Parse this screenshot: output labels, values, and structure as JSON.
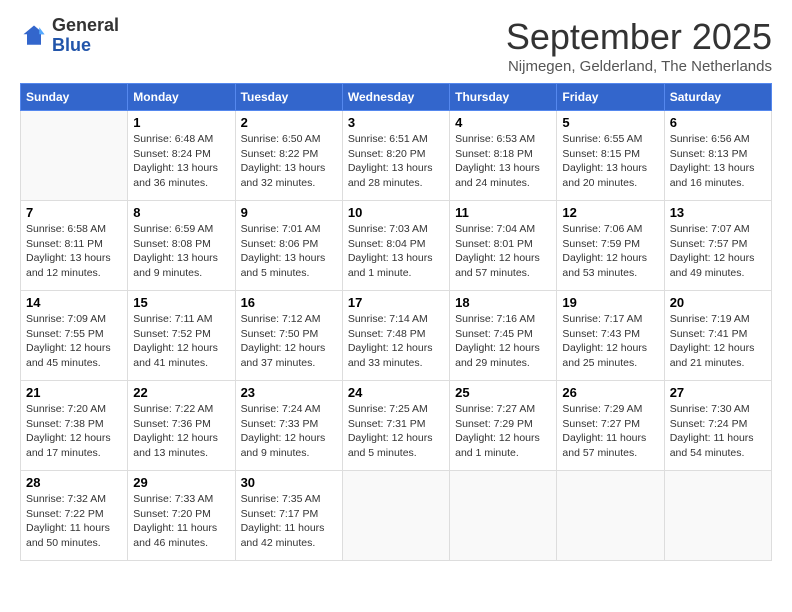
{
  "logo": {
    "general": "General",
    "blue": "Blue"
  },
  "title": "September 2025",
  "subtitle": "Nijmegen, Gelderland, The Netherlands",
  "days_of_week": [
    "Sunday",
    "Monday",
    "Tuesday",
    "Wednesday",
    "Thursday",
    "Friday",
    "Saturday"
  ],
  "weeks": [
    [
      {
        "day": "",
        "info": ""
      },
      {
        "day": "1",
        "info": "Sunrise: 6:48 AM\nSunset: 8:24 PM\nDaylight: 13 hours\nand 36 minutes."
      },
      {
        "day": "2",
        "info": "Sunrise: 6:50 AM\nSunset: 8:22 PM\nDaylight: 13 hours\nand 32 minutes."
      },
      {
        "day": "3",
        "info": "Sunrise: 6:51 AM\nSunset: 8:20 PM\nDaylight: 13 hours\nand 28 minutes."
      },
      {
        "day": "4",
        "info": "Sunrise: 6:53 AM\nSunset: 8:18 PM\nDaylight: 13 hours\nand 24 minutes."
      },
      {
        "day": "5",
        "info": "Sunrise: 6:55 AM\nSunset: 8:15 PM\nDaylight: 13 hours\nand 20 minutes."
      },
      {
        "day": "6",
        "info": "Sunrise: 6:56 AM\nSunset: 8:13 PM\nDaylight: 13 hours\nand 16 minutes."
      }
    ],
    [
      {
        "day": "7",
        "info": "Sunrise: 6:58 AM\nSunset: 8:11 PM\nDaylight: 13 hours\nand 12 minutes."
      },
      {
        "day": "8",
        "info": "Sunrise: 6:59 AM\nSunset: 8:08 PM\nDaylight: 13 hours\nand 9 minutes."
      },
      {
        "day": "9",
        "info": "Sunrise: 7:01 AM\nSunset: 8:06 PM\nDaylight: 13 hours\nand 5 minutes."
      },
      {
        "day": "10",
        "info": "Sunrise: 7:03 AM\nSunset: 8:04 PM\nDaylight: 13 hours\nand 1 minute."
      },
      {
        "day": "11",
        "info": "Sunrise: 7:04 AM\nSunset: 8:01 PM\nDaylight: 12 hours\nand 57 minutes."
      },
      {
        "day": "12",
        "info": "Sunrise: 7:06 AM\nSunset: 7:59 PM\nDaylight: 12 hours\nand 53 minutes."
      },
      {
        "day": "13",
        "info": "Sunrise: 7:07 AM\nSunset: 7:57 PM\nDaylight: 12 hours\nand 49 minutes."
      }
    ],
    [
      {
        "day": "14",
        "info": "Sunrise: 7:09 AM\nSunset: 7:55 PM\nDaylight: 12 hours\nand 45 minutes."
      },
      {
        "day": "15",
        "info": "Sunrise: 7:11 AM\nSunset: 7:52 PM\nDaylight: 12 hours\nand 41 minutes."
      },
      {
        "day": "16",
        "info": "Sunrise: 7:12 AM\nSunset: 7:50 PM\nDaylight: 12 hours\nand 37 minutes."
      },
      {
        "day": "17",
        "info": "Sunrise: 7:14 AM\nSunset: 7:48 PM\nDaylight: 12 hours\nand 33 minutes."
      },
      {
        "day": "18",
        "info": "Sunrise: 7:16 AM\nSunset: 7:45 PM\nDaylight: 12 hours\nand 29 minutes."
      },
      {
        "day": "19",
        "info": "Sunrise: 7:17 AM\nSunset: 7:43 PM\nDaylight: 12 hours\nand 25 minutes."
      },
      {
        "day": "20",
        "info": "Sunrise: 7:19 AM\nSunset: 7:41 PM\nDaylight: 12 hours\nand 21 minutes."
      }
    ],
    [
      {
        "day": "21",
        "info": "Sunrise: 7:20 AM\nSunset: 7:38 PM\nDaylight: 12 hours\nand 17 minutes."
      },
      {
        "day": "22",
        "info": "Sunrise: 7:22 AM\nSunset: 7:36 PM\nDaylight: 12 hours\nand 13 minutes."
      },
      {
        "day": "23",
        "info": "Sunrise: 7:24 AM\nSunset: 7:33 PM\nDaylight: 12 hours\nand 9 minutes."
      },
      {
        "day": "24",
        "info": "Sunrise: 7:25 AM\nSunset: 7:31 PM\nDaylight: 12 hours\nand 5 minutes."
      },
      {
        "day": "25",
        "info": "Sunrise: 7:27 AM\nSunset: 7:29 PM\nDaylight: 12 hours\nand 1 minute."
      },
      {
        "day": "26",
        "info": "Sunrise: 7:29 AM\nSunset: 7:27 PM\nDaylight: 11 hours\nand 57 minutes."
      },
      {
        "day": "27",
        "info": "Sunrise: 7:30 AM\nSunset: 7:24 PM\nDaylight: 11 hours\nand 54 minutes."
      }
    ],
    [
      {
        "day": "28",
        "info": "Sunrise: 7:32 AM\nSunset: 7:22 PM\nDaylight: 11 hours\nand 50 minutes."
      },
      {
        "day": "29",
        "info": "Sunrise: 7:33 AM\nSunset: 7:20 PM\nDaylight: 11 hours\nand 46 minutes."
      },
      {
        "day": "30",
        "info": "Sunrise: 7:35 AM\nSunset: 7:17 PM\nDaylight: 11 hours\nand 42 minutes."
      },
      {
        "day": "",
        "info": ""
      },
      {
        "day": "",
        "info": ""
      },
      {
        "day": "",
        "info": ""
      },
      {
        "day": "",
        "info": ""
      }
    ]
  ]
}
